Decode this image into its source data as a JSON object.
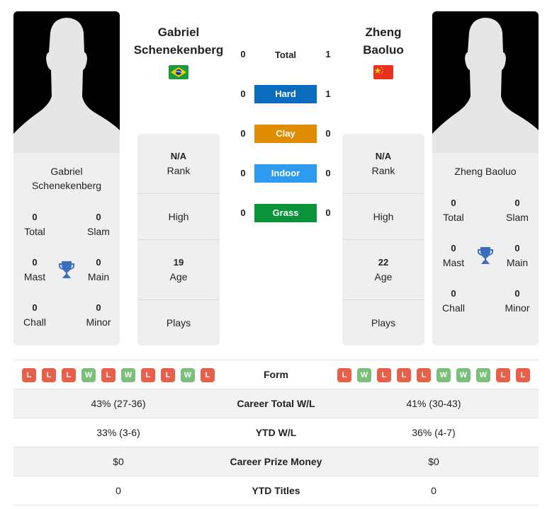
{
  "players": {
    "left": {
      "name_line1": "Gabriel",
      "name_line2": "Schenekenberg",
      "card_name_line1": "Gabriel",
      "card_name_line2": "Schenekenberg",
      "flag": "brazil-flag",
      "stats": {
        "total": {
          "value": "0",
          "label": "Total"
        },
        "slam": {
          "value": "0",
          "label": "Slam"
        },
        "mast": {
          "value": "0",
          "label": "Mast"
        },
        "main": {
          "value": "0",
          "label": "Main"
        },
        "chall": {
          "value": "0",
          "label": "Chall"
        },
        "minor": {
          "value": "0",
          "label": "Minor"
        }
      },
      "info": {
        "rank_value": "N/A",
        "rank_label": "Rank",
        "high_label": "High",
        "age_value": "19",
        "age_label": "Age",
        "plays_label": "Plays"
      }
    },
    "right": {
      "name_line1": "Zheng",
      "name_line2": "Baoluo",
      "card_name": "Zheng Baoluo",
      "flag": "china-flag",
      "stats": {
        "total": {
          "value": "0",
          "label": "Total"
        },
        "slam": {
          "value": "0",
          "label": "Slam"
        },
        "mast": {
          "value": "0",
          "label": "Mast"
        },
        "main": {
          "value": "0",
          "label": "Main"
        },
        "chall": {
          "value": "0",
          "label": "Chall"
        },
        "minor": {
          "value": "0",
          "label": "Minor"
        }
      },
      "info": {
        "rank_value": "N/A",
        "rank_label": "Rank",
        "high_label": "High",
        "age_value": "22",
        "age_label": "Age",
        "plays_label": "Plays"
      }
    }
  },
  "h2h": [
    {
      "label": "Total",
      "left": "0",
      "right": "1",
      "color": null
    },
    {
      "label": "Hard",
      "left": "0",
      "right": "1",
      "color": "#0b6bbf"
    },
    {
      "label": "Clay",
      "left": "0",
      "right": "0",
      "color": "#df8c00"
    },
    {
      "label": "Indoor",
      "left": "0",
      "right": "0",
      "color": "#2f9bf0"
    },
    {
      "label": "Grass",
      "left": "0",
      "right": "0",
      "color": "#0a9339"
    }
  ],
  "comparison": {
    "form_label": "Form",
    "left_form": [
      "L",
      "L",
      "L",
      "W",
      "L",
      "W",
      "L",
      "L",
      "W",
      "L"
    ],
    "right_form": [
      "L",
      "W",
      "L",
      "L",
      "L",
      "W",
      "W",
      "W",
      "L",
      "L"
    ],
    "rows": [
      {
        "label": "Career Total W/L",
        "left": "43% (27-36)",
        "right": "41% (30-43)"
      },
      {
        "label": "YTD W/L",
        "left": "33% (3-6)",
        "right": "36% (4-7)"
      },
      {
        "label": "Career Prize Money",
        "left": "$0",
        "right": "$0"
      },
      {
        "label": "YTD Titles",
        "left": "0",
        "right": "0"
      }
    ]
  },
  "colors": {
    "loss": "#e8604a",
    "win": "#7bbf7b",
    "trophy": "#3a6fc0"
  }
}
